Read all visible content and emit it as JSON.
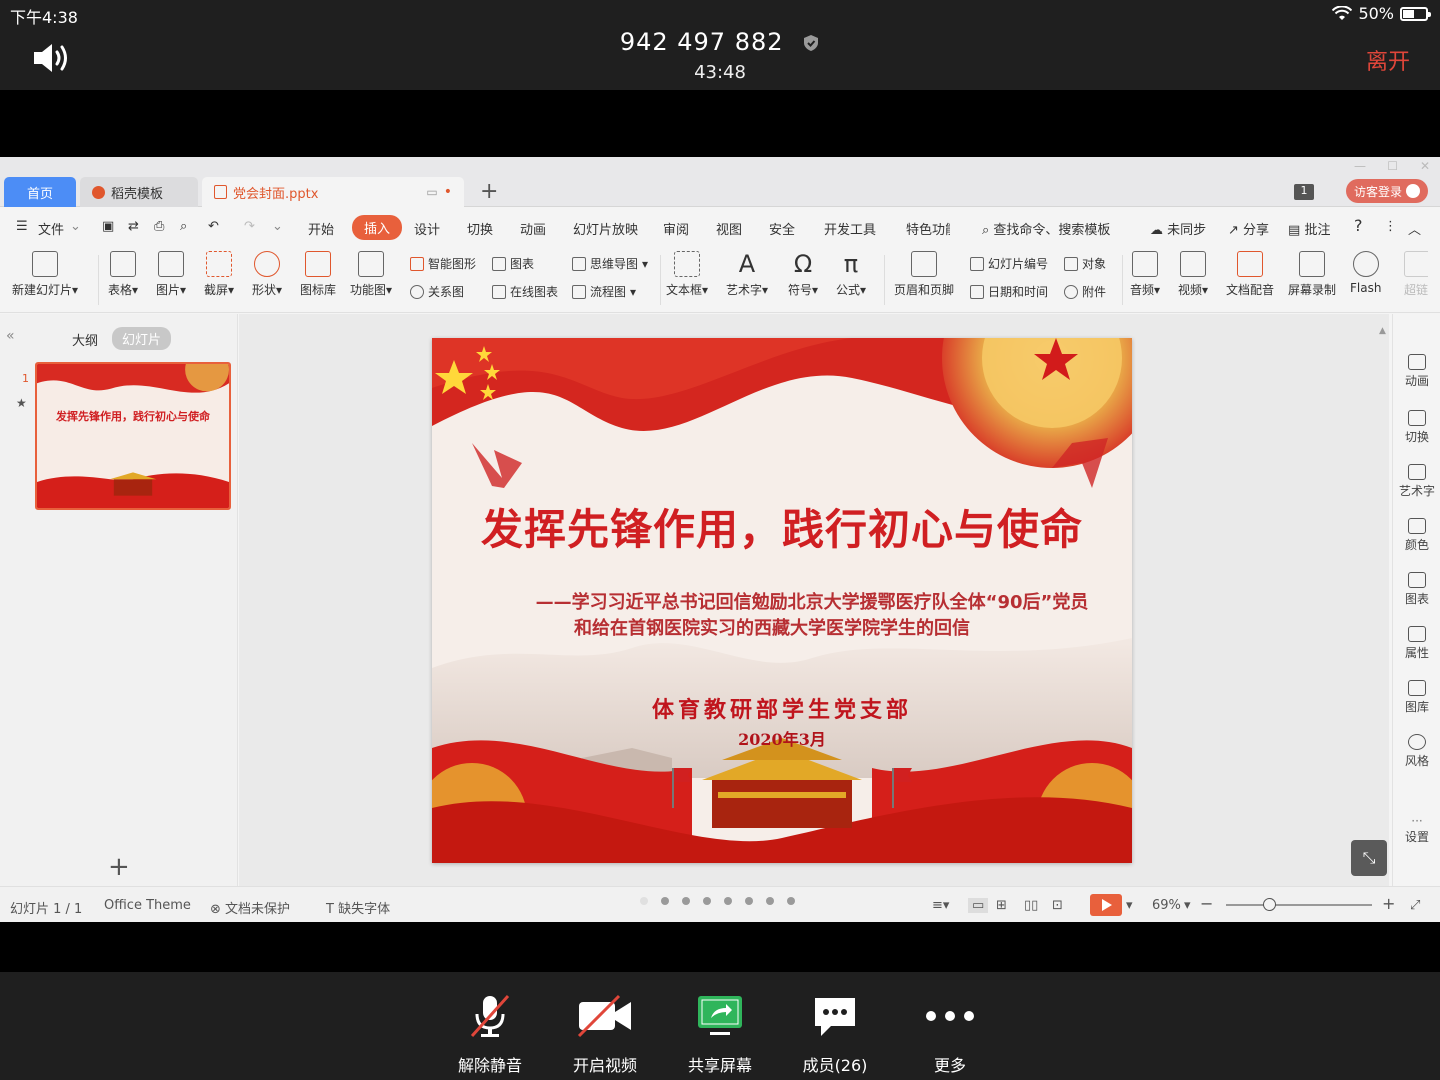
{
  "status": {
    "time": "下午4:38",
    "battery": "50%"
  },
  "meeting": {
    "id": "942 497 882",
    "timer": "43:48",
    "leave": "离开"
  },
  "tabs": {
    "home": "首页",
    "template": "稻壳模板",
    "document": "党会封面.pptx",
    "visitor": "访客登录",
    "window_badge": "1"
  },
  "menu": {
    "items": [
      "文件",
      "开始",
      "插入",
      "设计",
      "切换",
      "动画",
      "幻灯片放映",
      "审阅",
      "视图",
      "安全",
      "开发工具",
      "特色功能"
    ],
    "search": "查找命令、搜索模板",
    "sync": "未同步",
    "share": "分享",
    "comment": "批注",
    "help": "?"
  },
  "ribbon": {
    "new_slide": "新建幻灯片",
    "table": "表格",
    "picture": "图片",
    "screenshot": "截屏",
    "shape": "形状",
    "icon_lib": "图标库",
    "func_chart": "功能图",
    "smart_shape": "智能图形",
    "chart": "图表",
    "relation": "关系图",
    "online_chart": "在线图表",
    "mindmap": "思维导图",
    "flowchart": "流程图",
    "textbox": "文本框",
    "wordart": "艺术字",
    "symbol": "符号",
    "formula": "公式",
    "header_footer": "页眉和页脚",
    "slide_number": "幻灯片编号",
    "object": "对象",
    "datetime": "日期和时间",
    "attachment": "附件",
    "audio": "音频",
    "video": "视频",
    "doc_dub": "文档配音",
    "screen_rec": "屏幕录制",
    "flash": "Flash",
    "more": "超链"
  },
  "left_panel": {
    "outline": "大纲",
    "slides": "幻灯片",
    "slide_number": "1",
    "thumb_title": "发挥先锋作用，践行初心与使命"
  },
  "slide": {
    "title": "发挥先锋作用，践行初心与使命",
    "subtitle_line1": "——学习习近平总书记回信勉励北京大学援鄂医疗队全体“90后”党员",
    "subtitle_line2": "和给在首钢医院实习的西藏大学医学院学生的回信",
    "department": "体育教研部学生党支部",
    "date": "2020年3月"
  },
  "right_panel": [
    "动画",
    "切换",
    "艺术字",
    "颜色",
    "图表",
    "属性",
    "图库",
    "风格",
    "设置"
  ],
  "statusbar": {
    "slide_count": "幻灯片 1 / 1",
    "theme": "Office Theme",
    "protect": "文档未保护",
    "font_missing": "缺失字体",
    "zoom": "69%",
    "zoom_level_fraction": 0.3
  },
  "controls": {
    "unmute": "解除静音",
    "video": "开启视频",
    "share": "共享屏幕",
    "members": "成员(26)",
    "more": "更多"
  },
  "colors": {
    "accent": "#e8603c",
    "slide_red": "#d01f22",
    "leave_red": "#e0463a",
    "share_green": "#2fb55b"
  }
}
